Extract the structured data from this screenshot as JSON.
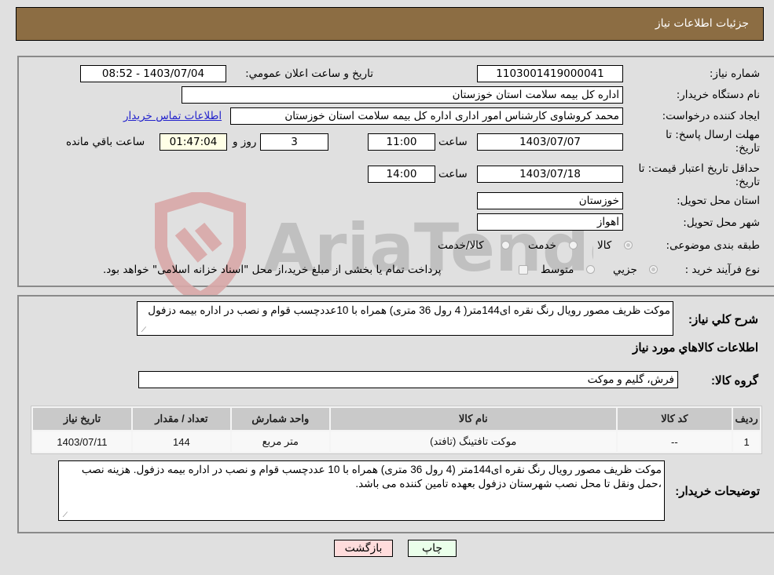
{
  "header": {
    "title": "جزئیات اطلاعات نیاز"
  },
  "form": {
    "need_number": {
      "label": "شماره نیاز:",
      "value": "1103001419000041"
    },
    "announce_datetime": {
      "label": "تاریخ و ساعت اعلان عمومي:",
      "value": "1403/07/04 - 08:52"
    },
    "buyer_org": {
      "label": "نام دستگاه خریدار:",
      "value": "اداره کل بیمه سلامت استان خوزستان"
    },
    "requester": {
      "label": "ایجاد کننده درخواست:",
      "value": "محمد کروشاوی کارشناس امور اداری اداره کل بیمه سلامت استان خوزستان"
    },
    "buyer_contact_link": "اطلاعات تماس خریدار",
    "reply_deadline": {
      "label_line1": "مهلت ارسال پاسخ: تا",
      "label_line2": "تاریخ:",
      "date": "1403/07/07",
      "time_label": "ساعت",
      "time": "11:00",
      "days": "3",
      "days_label": "روز و",
      "remaining": "01:47:04",
      "remaining_label": "ساعت باقي مانده"
    },
    "price_validity": {
      "label_line1": "حداقل تاریخ اعتبار قیمت: تا",
      "label_line2": "تاریخ:",
      "date": "1403/07/18",
      "time_label": "ساعت",
      "time": "14:00"
    },
    "delivery_province": {
      "label": "استان محل تحویل:",
      "value": "خوزستان"
    },
    "delivery_city": {
      "label": "شهر محل تحویل:",
      "value": "اهواز"
    },
    "category": {
      "label": "طبقه بندی موضوعی:",
      "options": [
        "کالا",
        "خدمت",
        "کالا/خدمت"
      ],
      "selected": "کالا"
    },
    "purchase_type": {
      "label": "نوع فرآیند خرید :",
      "options": [
        "جزيي",
        "متوسط"
      ],
      "selected": "جزيي",
      "treasury_note": "پرداخت تمام یا بخشی از مبلغ خرید،از محل \"اسناد خزانه اسلامی\" خواهد بود."
    }
  },
  "details": {
    "summary_label": "شرح كلي نياز:",
    "summary_text": "موکت ظریف مصور  رویال رنگ نقره ای144متر( 4 رول 36 متری) همراه با 10عددچسب قوام و نصب در اداره بیمه دزفول",
    "goods_info_title": "اطلاعات كالاهاي مورد نياز",
    "goods_group_label": "گروه کالا:",
    "goods_group_value": "فرش، گلیم و موکت",
    "table": {
      "headers": [
        "ردیف",
        "کد کالا",
        "نام کالا",
        "واحد شمارش",
        "تعداد / مقدار",
        "تاریخ نیاز"
      ],
      "rows": [
        [
          "1",
          "--",
          "موکت تافتینگ (تافتد)",
          "متر مربع",
          "144",
          "1403/07/11"
        ]
      ]
    },
    "buyer_notes_label": "توضیحات خریدار:",
    "buyer_notes_text": "موکت ظریف مصور رویال رنگ نقره ای144متر (4 رول 36 متری) همراه با 10 عددچسب قوام و نصب در اداره بیمه دزفول. هزینه نصب ،حمل ونقل تا محل نصب شهرستان دزفول بعهده  تامین کننده می باشد."
  },
  "buttons": {
    "print": "چاپ",
    "back": "بازگشت"
  },
  "watermark": {
    "text": "AriaTender.neT"
  },
  "colors": {
    "header_bg": "#8c6d43",
    "print_btn_bg": "#eaffea",
    "back_btn_bg": "#ffdcdc",
    "link": "#2222cc"
  }
}
